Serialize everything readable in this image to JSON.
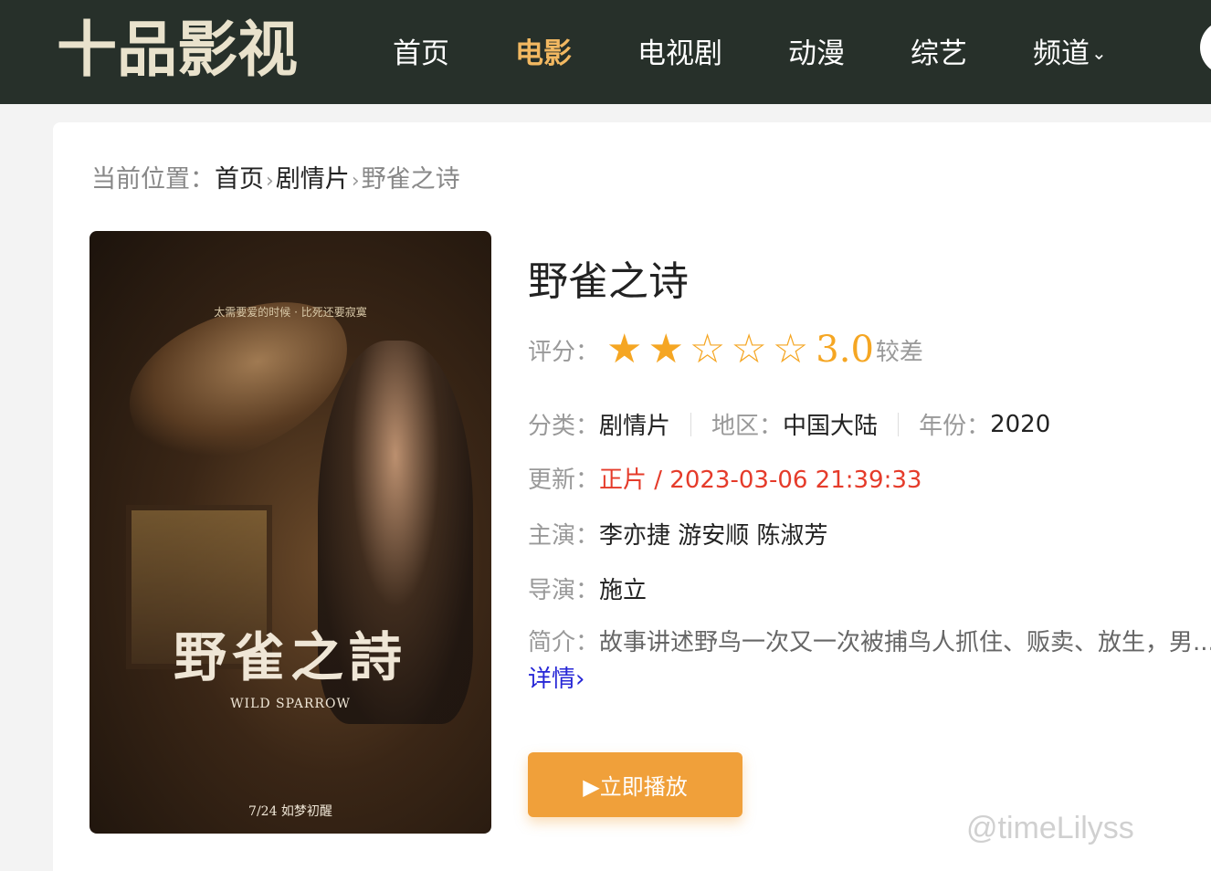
{
  "site": {
    "logo_chars": [
      "十",
      "品",
      "影",
      "视"
    ]
  },
  "nav": {
    "items": [
      {
        "label": "首页",
        "active": false
      },
      {
        "label": "电影",
        "active": true
      },
      {
        "label": "电视剧",
        "active": false
      },
      {
        "label": "动漫",
        "active": false
      },
      {
        "label": "综艺",
        "active": false
      },
      {
        "label": "频道",
        "active": false
      }
    ],
    "dropdown_icon": "chevron-down-icon",
    "active_color": "#f2b861",
    "header_bg": "#27302a"
  },
  "breadcrumb": {
    "prefix": "当前位置：",
    "home": "首页",
    "category": "剧情片",
    "current": "野雀之诗"
  },
  "poster": {
    "tagline": "太需要爱的时候 · 比死还要寂寞",
    "cn_title": "野雀之詩",
    "en_title": "WILD SPARROW",
    "date_text": "7/24 如梦初醒"
  },
  "movie": {
    "title": "野雀之诗",
    "rating_label": "评分：",
    "rating_stars": 2,
    "rating_max": 5,
    "score": "3.0",
    "score_word": "较差",
    "category_label": "分类：",
    "category": "剧情片",
    "region_label": "地区：",
    "region": "中国大陆",
    "year_label": "年份：",
    "year": "2020",
    "update_label": "更新：",
    "update_value": "正片 / 2023-03-06 21:39:33",
    "cast_label": "主演：",
    "cast": "李亦捷 游安顺 陈淑芳",
    "director_label": "导演：",
    "director": "施立",
    "synopsis_label": "简介：",
    "synopsis": "故事讲述野鸟一次又一次被捕鸟人抓住、贩卖、放生，男...",
    "more_label": "详情›"
  },
  "actions": {
    "play_label": "▶立即播放",
    "play_color": "#f0a03a"
  },
  "watermark": "@timeLilyss"
}
